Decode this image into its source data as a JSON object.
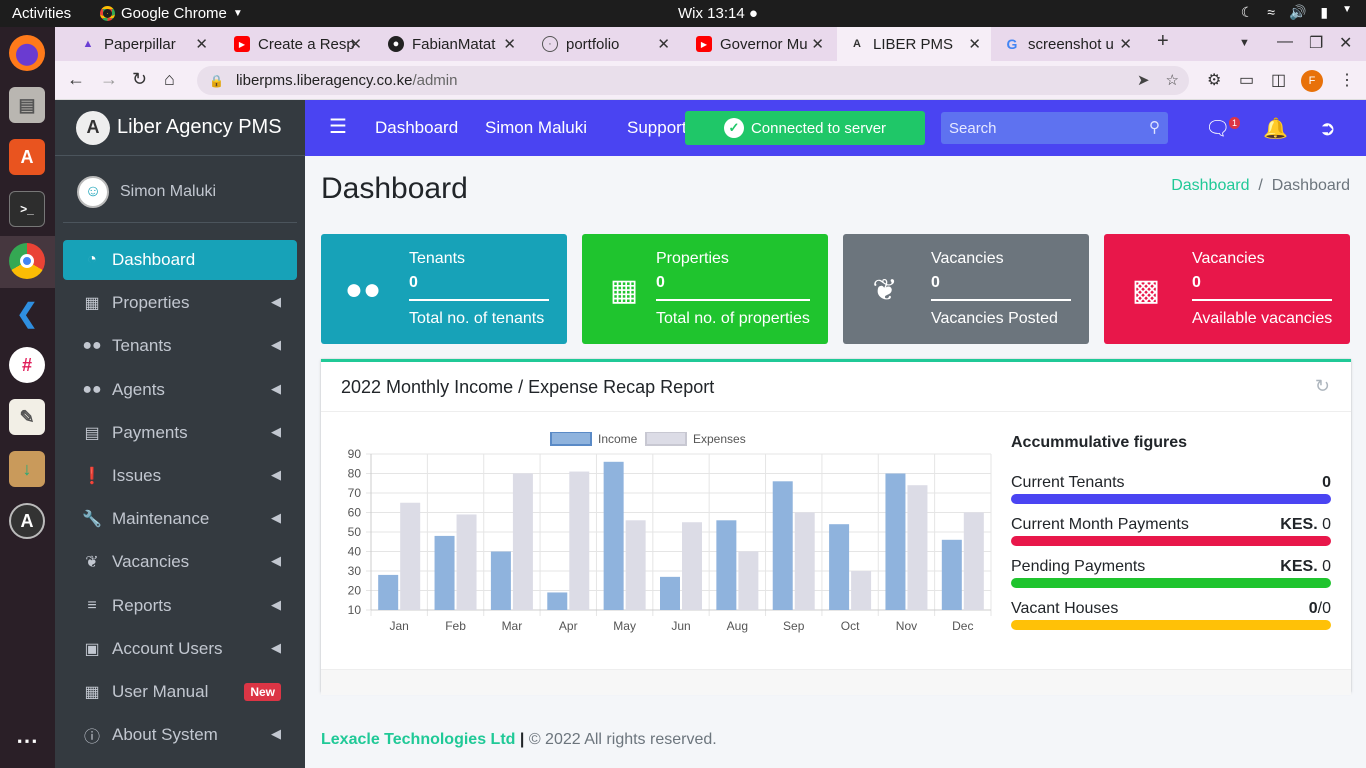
{
  "system": {
    "activities": "Activities",
    "app_name": "Google Chrome",
    "clock": "Wix 13:14 ●"
  },
  "browser": {
    "tabs": [
      {
        "title": "Paperpillar",
        "icon": "paperpillar-icon"
      },
      {
        "title": "Create a Resp",
        "icon": "youtube-icon"
      },
      {
        "title": "FabianMatat",
        "icon": "github-icon"
      },
      {
        "title": "portfolio",
        "icon": "globe-icon"
      },
      {
        "title": "Governor Mu",
        "icon": "youtube-icon"
      },
      {
        "title": "LIBER PMS",
        "icon": "liber-icon",
        "active": true
      },
      {
        "title": "screenshot u",
        "icon": "google-icon"
      }
    ],
    "url_host": "liberpms.liberagency.co.ke",
    "url_path": "/admin",
    "profile_initial": "F"
  },
  "sidebar": {
    "brand": "Liber Agency PMS",
    "user": "Simon Maluki",
    "items": [
      {
        "label": "Dashboard",
        "icon": "dashboard-icon",
        "active": true
      },
      {
        "label": "Properties",
        "icon": "building-icon"
      },
      {
        "label": "Tenants",
        "icon": "users-icon"
      },
      {
        "label": "Agents",
        "icon": "users-icon"
      },
      {
        "label": "Payments",
        "icon": "list-icon"
      },
      {
        "label": "Issues",
        "icon": "exclamation-icon"
      },
      {
        "label": "Maintenance",
        "icon": "wrench-icon"
      },
      {
        "label": "Vacancies",
        "icon": "leaf-icon"
      },
      {
        "label": "Reports",
        "icon": "lines-icon"
      },
      {
        "label": "Account Users",
        "icon": "id-card-icon"
      },
      {
        "label": "User Manual",
        "icon": "grid-icon",
        "badge": "New"
      },
      {
        "label": "About System",
        "icon": "info-icon"
      }
    ]
  },
  "navbar": {
    "links": [
      "Dashboard",
      "Simon Maluki",
      "Support"
    ],
    "status": "Connected to server",
    "search_placeholder": "Search",
    "messages_count": "1"
  },
  "page": {
    "title": "Dashboard",
    "breadcrumb": [
      "Dashboard",
      "Dashboard"
    ]
  },
  "info_boxes": [
    {
      "label": "Tenants",
      "value": "0",
      "desc": "Total no. of tenants",
      "color": "#17a2b8",
      "icon": "users-icon"
    },
    {
      "label": "Properties",
      "value": "0",
      "desc": "Total no. of properties",
      "color": "#1fc42e",
      "icon": "building-icon"
    },
    {
      "label": "Vacancies",
      "value": "0",
      "desc": "Vacancies Posted",
      "color": "#6c757d",
      "icon": "leaf-icon"
    },
    {
      "label": "Vacancies",
      "value": "0",
      "desc": "Available vacancies",
      "color": "#e8174a",
      "icon": "store-icon"
    }
  ],
  "report": {
    "title": "2022 Monthly Income / Expense Recap Report",
    "accumulative": {
      "title": "Accummulative figures",
      "rows": [
        {
          "label": "Current Tenants",
          "prefix": "",
          "value": "0",
          "color": "#4a44f2"
        },
        {
          "label": "Current Month Payments",
          "prefix": "KES.",
          "value": "0",
          "color": "#e8174a"
        },
        {
          "label": "Pending Payments",
          "prefix": "KES.",
          "value": "0",
          "color": "#1fc42e"
        },
        {
          "label": "Vacant Houses",
          "prefix": "0",
          "value": "/0",
          "color": "#ffc107"
        }
      ]
    }
  },
  "chart_data": {
    "type": "bar",
    "categories": [
      "Jan",
      "Feb",
      "Mar",
      "Apr",
      "May",
      "Jun",
      "Aug",
      "Sep",
      "Oct",
      "Nov",
      "Dec"
    ],
    "series": [
      {
        "name": "Income",
        "values": [
          28,
          48,
          40,
          19,
          86,
          27,
          56,
          76,
          54,
          80,
          46
        ],
        "color": "#8fb3dd"
      },
      {
        "name": "Expenses",
        "values": [
          65,
          59,
          80,
          81,
          56,
          55,
          40,
          60,
          30,
          74,
          60
        ],
        "color": "#dcdce6"
      }
    ],
    "yticks": [
      10,
      20,
      30,
      40,
      50,
      60,
      70,
      80,
      90
    ],
    "ylim": [
      10,
      90
    ],
    "grid": true,
    "legend": "top"
  },
  "footer": {
    "company": "Lexacle Technologies Ltd",
    "sep": "|",
    "rights": "© 2022 All rights reserved."
  }
}
